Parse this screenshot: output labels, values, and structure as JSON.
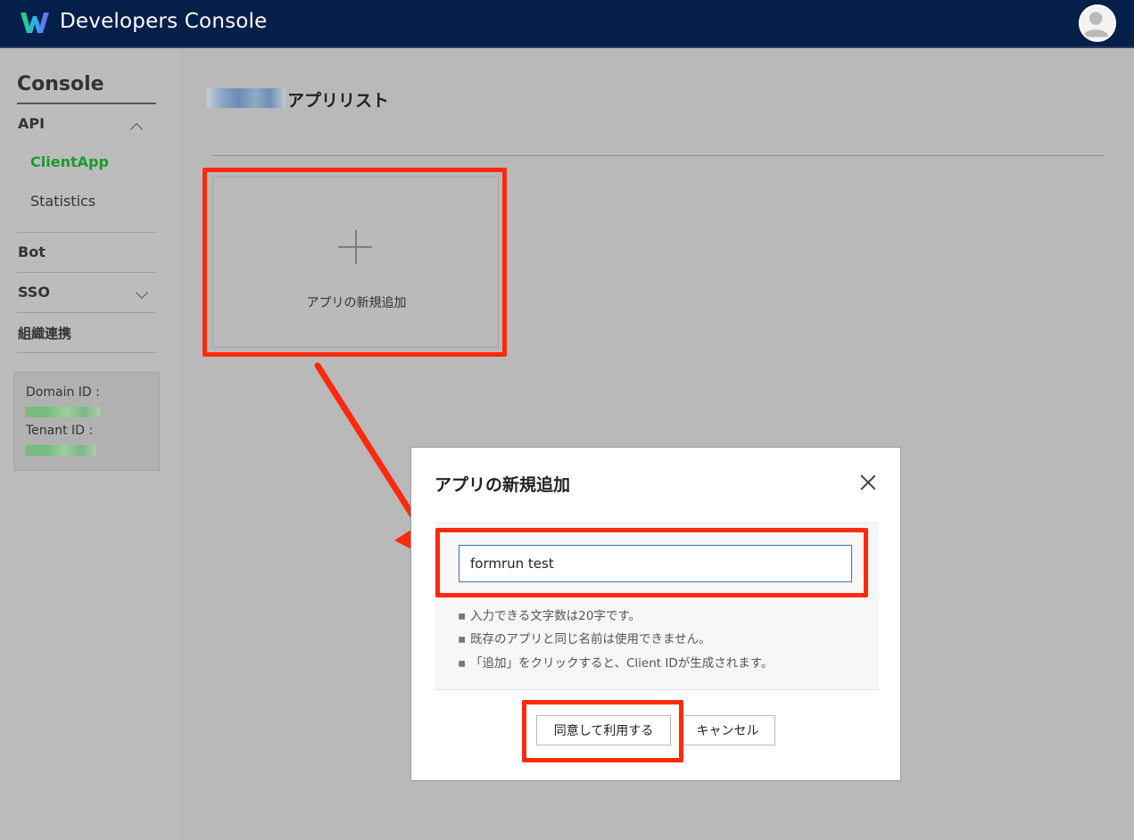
{
  "header": {
    "title": "Developers Console",
    "logo_icon": "works-logo-icon",
    "avatar_icon": "user-avatar-icon"
  },
  "sidebar": {
    "title": "Console",
    "api": {
      "label": "API",
      "sub": [
        {
          "label": "ClientApp",
          "active": true
        },
        {
          "label": "Statistics",
          "active": false
        }
      ]
    },
    "bot": {
      "label": "Bot"
    },
    "sso": {
      "label": "SSO"
    },
    "org": {
      "label": "組織連携"
    },
    "domain_id_label": "Domain ID :",
    "tenant_id_label": "Tenant ID :"
  },
  "main": {
    "page_title": "アプリリスト",
    "add_card_label": "アプリの新規追加"
  },
  "dialog": {
    "title": "アプリの新規追加",
    "input_value": "formrun test",
    "notes": [
      "入力できる文字数は20字です。",
      "既存のアプリと同じ名前は使用できません。",
      "「追加」をクリックすると、Client IDが生成されます。"
    ],
    "confirm_label": "同意して利用する",
    "cancel_label": "キャンセル"
  },
  "colors": {
    "header_bg": "#041f4a",
    "highlight": "#ff2a0c",
    "active_nav": "#1e9a2e",
    "input_border": "#3f73b3"
  }
}
